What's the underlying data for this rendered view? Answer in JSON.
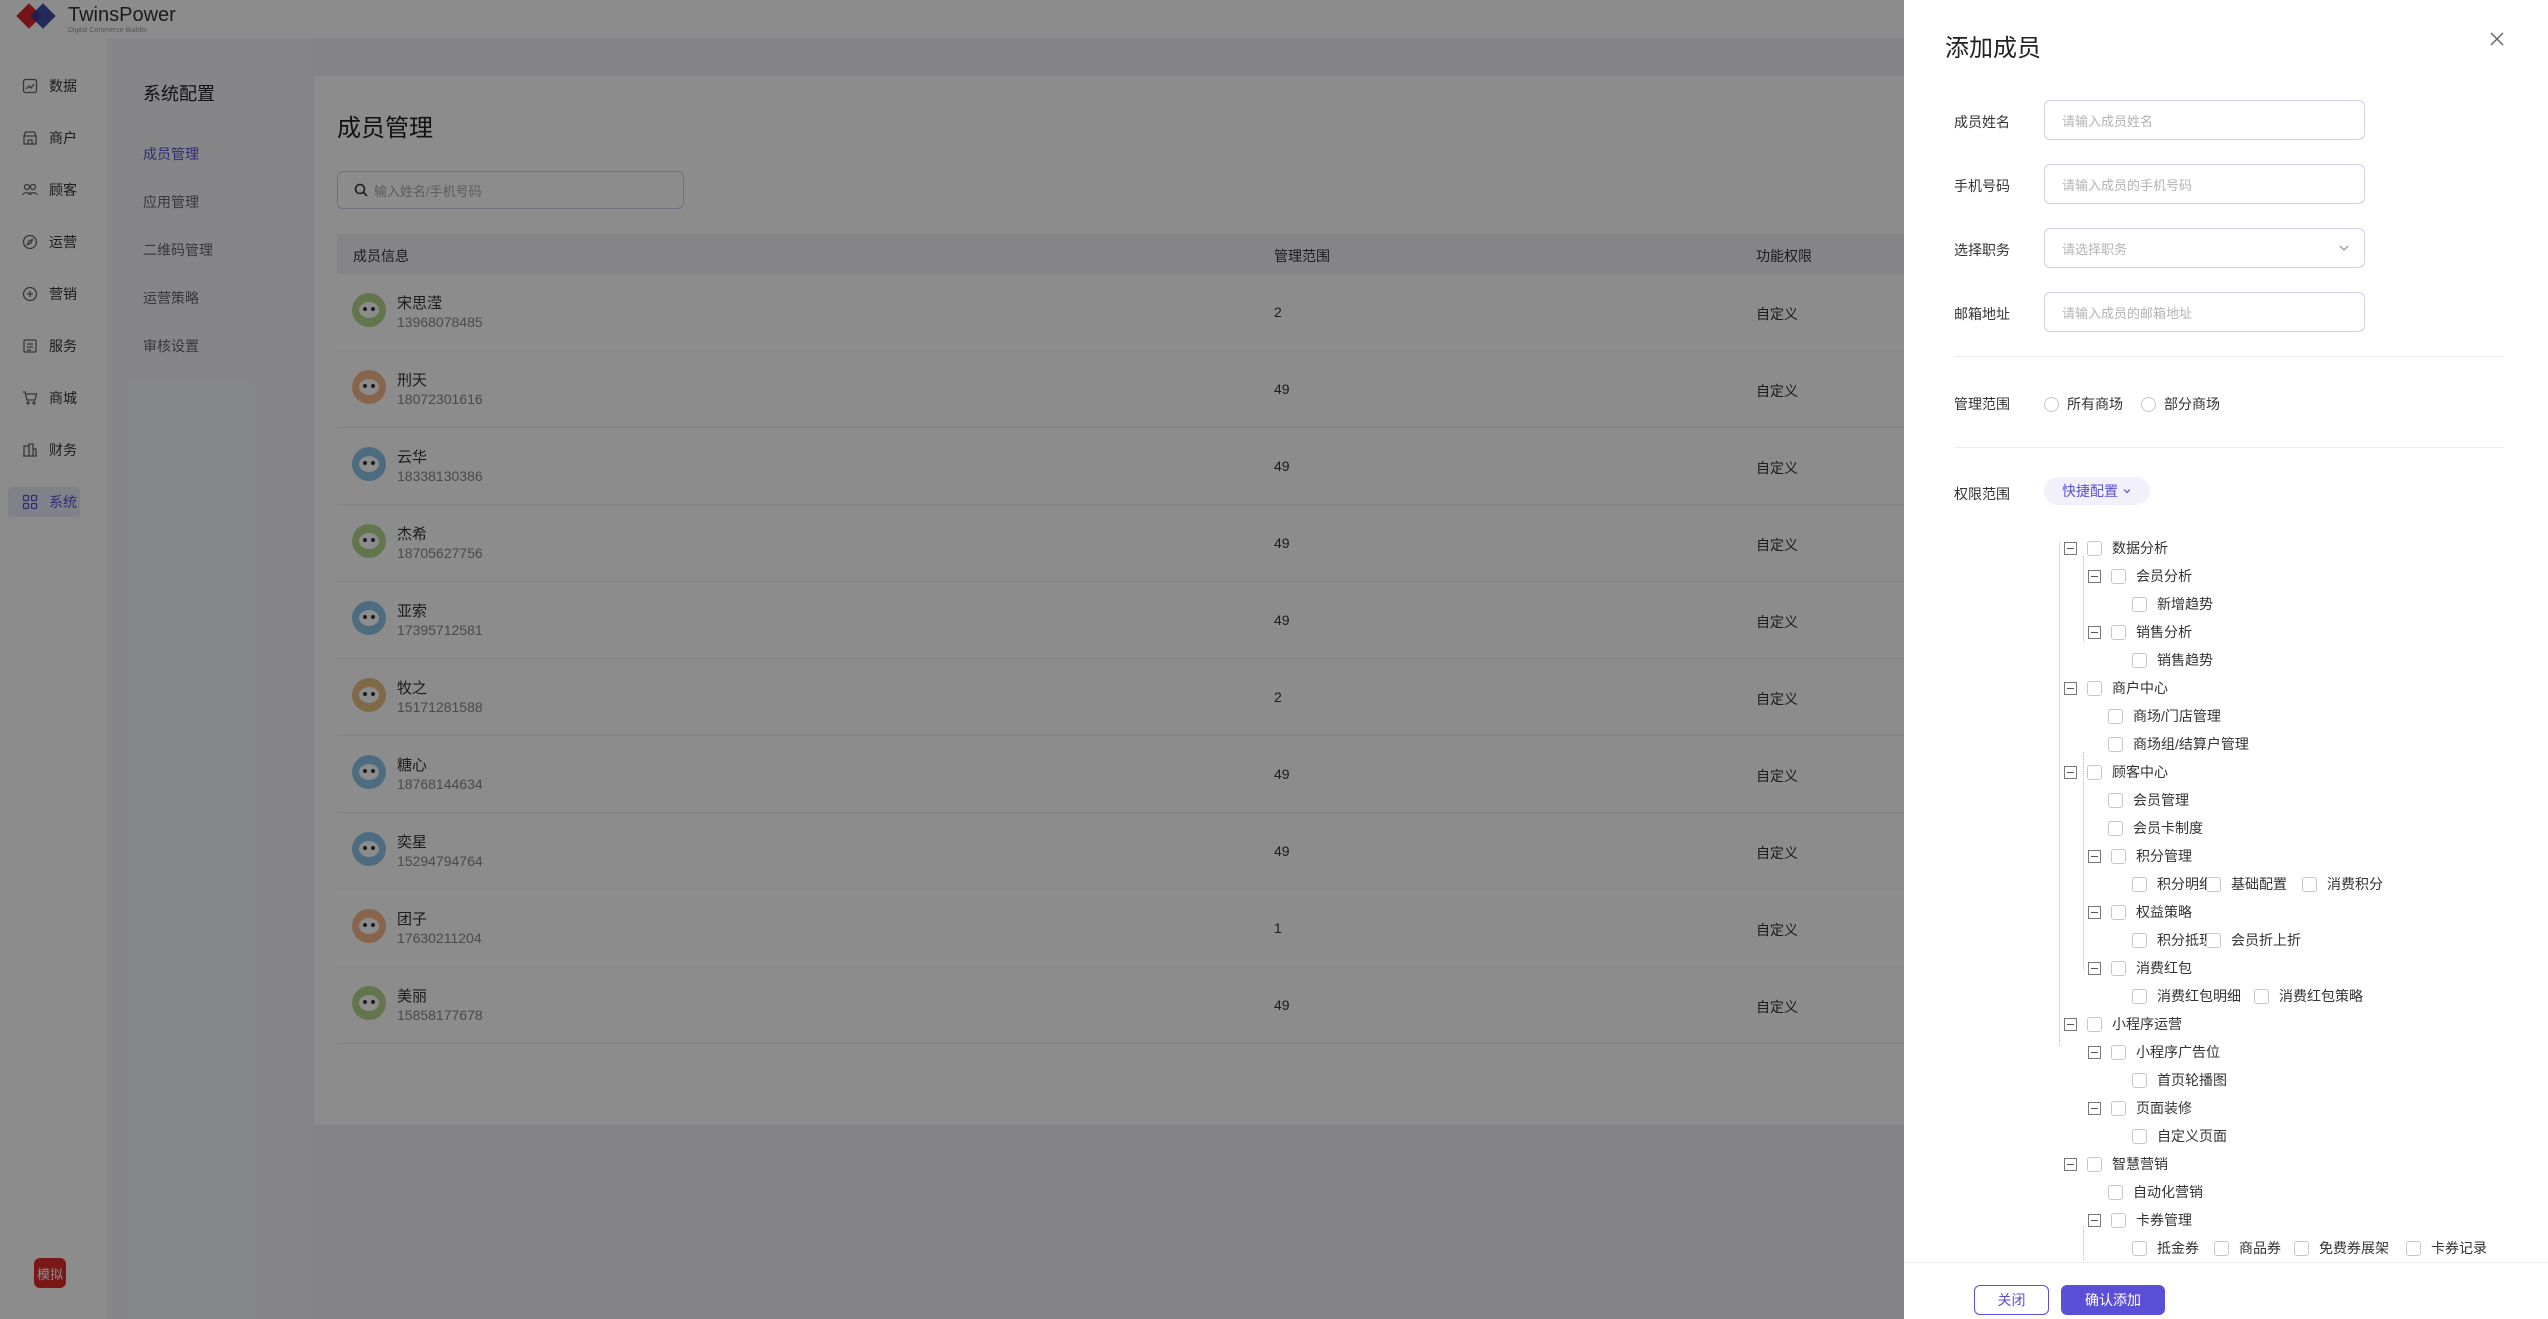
{
  "brand": {
    "name": "TwinsPower",
    "tagline": "Digital Commerce Builder"
  },
  "nav": [
    {
      "label": "数据",
      "icon": "chart-icon"
    },
    {
      "label": "商户",
      "icon": "store-icon"
    },
    {
      "label": "顾客",
      "icon": "customers-icon"
    },
    {
      "label": "运营",
      "icon": "compass-icon"
    },
    {
      "label": "营销",
      "icon": "marketing-icon"
    },
    {
      "label": "服务",
      "icon": "service-icon"
    },
    {
      "label": "商城",
      "icon": "cart-icon"
    },
    {
      "label": "财务",
      "icon": "finance-icon"
    },
    {
      "label": "系统",
      "icon": "grid-icon",
      "active": true
    }
  ],
  "demo_badge": "模拟",
  "subnav": {
    "title": "系统配置",
    "items": [
      {
        "label": "成员管理",
        "active": true
      },
      {
        "label": "应用管理"
      },
      {
        "label": "二维码管理"
      },
      {
        "label": "运营策略"
      },
      {
        "label": "审核设置"
      }
    ]
  },
  "page": {
    "title": "成员管理",
    "search_placeholder": "输入姓名/手机号码",
    "columns": [
      "成员信息",
      "管理范围",
      "功能权限"
    ],
    "rows": [
      {
        "name": "宋思滢",
        "phone": "13968078485",
        "scope": "2",
        "perm": "自定义",
        "avatar_color": "#b5d68a"
      },
      {
        "name": "刑天",
        "phone": "18072301616",
        "scope": "49",
        "perm": "自定义",
        "avatar_color": "#f5b98a"
      },
      {
        "name": "云华",
        "phone": "18338130386",
        "scope": "49",
        "perm": "自定义",
        "avatar_color": "#8ec5ea"
      },
      {
        "name": "杰希",
        "phone": "18705627756",
        "scope": "49",
        "perm": "自定义",
        "avatar_color": "#b5d68a"
      },
      {
        "name": "亚索",
        "phone": "17395712581",
        "scope": "49",
        "perm": "自定义",
        "avatar_color": "#8ec5ea"
      },
      {
        "name": "牧之",
        "phone": "15171281588",
        "scope": "2",
        "perm": "自定义",
        "avatar_color": "#e8c080"
      },
      {
        "name": "糖心",
        "phone": "18768144634",
        "scope": "49",
        "perm": "自定义",
        "avatar_color": "#8ec5ea"
      },
      {
        "name": "奕星",
        "phone": "15294794764",
        "scope": "49",
        "perm": "自定义",
        "avatar_color": "#8ec5ea"
      },
      {
        "name": "团子",
        "phone": "17630211204",
        "scope": "1",
        "perm": "自定义",
        "avatar_color": "#f5b98a"
      },
      {
        "name": "美丽",
        "phone": "15858177678",
        "scope": "49",
        "perm": "自定义",
        "avatar_color": "#b5d68a"
      }
    ]
  },
  "drawer": {
    "title": "添加成员",
    "fields": [
      {
        "label": "成员姓名",
        "placeholder": "请输入成员姓名"
      },
      {
        "label": "手机号码",
        "placeholder": "请输入成员的手机号码"
      },
      {
        "label": "选择职务",
        "placeholder": "请选择职务"
      },
      {
        "label": "邮箱地址",
        "placeholder": "请输入成员的邮箱地址"
      }
    ],
    "scope_label": "管理范围",
    "scope_options": [
      "所有商场",
      "部分商场"
    ],
    "perm_label": "权限范围",
    "quick_config": "快捷配置",
    "tree": {
      "data_analysis": "数据分析",
      "member_analysis": "会员分析",
      "new_trend": "新增趋势",
      "sales_analysis": "销售分析",
      "sales_trend": "销售趋势",
      "merchant_center": "商户中心",
      "mall_store_mgmt": "商场/门店管理",
      "mall_group_mgmt": "商场组/结算户管理",
      "customer_center": "顾客中心",
      "member_mgmt": "会员管理",
      "member_card": "会员卡制度",
      "points_mgmt": "积分管理",
      "points_detail": "积分明细",
      "basic_config": "基础配置",
      "consume_points": "消费积分",
      "benefit_strategy": "权益策略",
      "points_offset": "积分抵现",
      "member_discount": "会员折上折",
      "red_packet": "消费红包",
      "red_packet_detail": "消费红包明细",
      "red_packet_strategy": "消费红包策略",
      "mini_ops": "小程序运营",
      "mini_ad": "小程序广告位",
      "home_banner": "首页轮播图",
      "page_decor": "页面装修",
      "custom_page": "自定义页面",
      "smart_marketing": "智慧营销",
      "auto_marketing": "自动化营销",
      "coupon_mgmt": "卡券管理",
      "cash_coupon": "抵金券",
      "goods_coupon": "商品券",
      "free_coupon_shelf": "免费券展架",
      "coupon_record": "卡券记录"
    },
    "close_label": "关闭",
    "confirm_label": "确认添加"
  },
  "colors": {
    "accent": "#5b4fd6",
    "demo_badge": "#e02a2a"
  }
}
